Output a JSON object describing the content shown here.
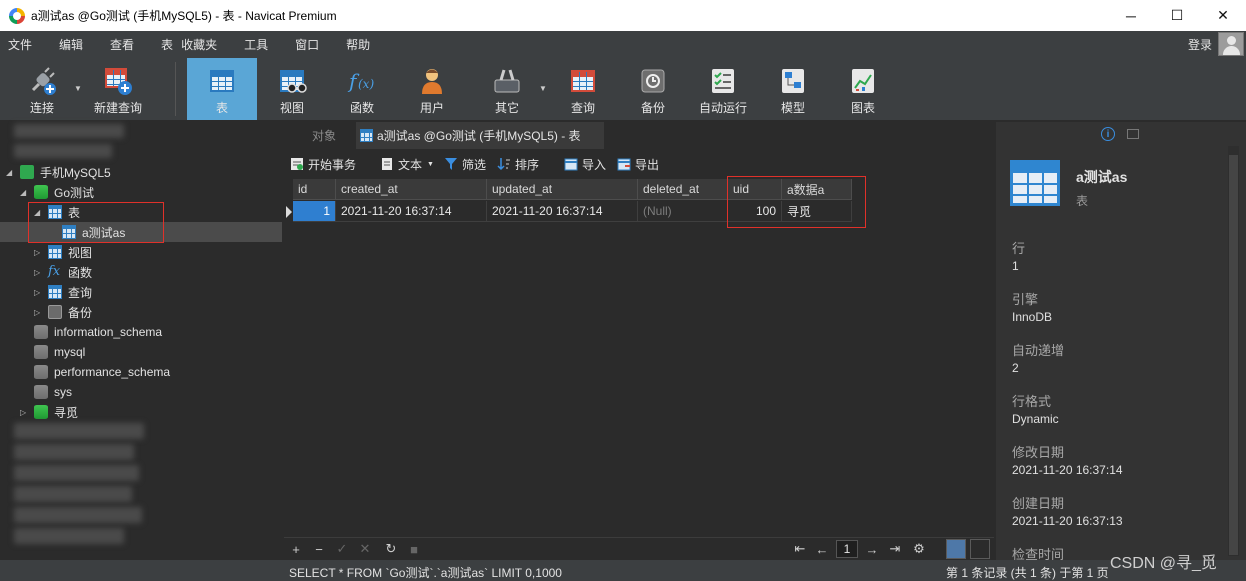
{
  "window": {
    "title": "a测试as @Go测试 (手机MySQL5) - 表 - Navicat Premium",
    "min_glyph": "─",
    "max_glyph": "☐",
    "close_glyph": "✕"
  },
  "menu": [
    "文件",
    "编辑",
    "查看",
    "表",
    "收藏夹",
    "工具",
    "窗口",
    "帮助"
  ],
  "account": {
    "login_label": "登录"
  },
  "toolbar": {
    "items": [
      {
        "label": "连接",
        "icon": "plug-icon"
      },
      {
        "label": "新建查询",
        "icon": "new-query-icon"
      },
      {
        "label": "表",
        "icon": "table-icon",
        "active": true
      },
      {
        "label": "视图",
        "icon": "view-icon"
      },
      {
        "label": "函数",
        "icon": "function-icon"
      },
      {
        "label": "用户",
        "icon": "user-icon"
      },
      {
        "label": "其它",
        "icon": "tools-icon"
      },
      {
        "label": "查询",
        "icon": "query-icon"
      },
      {
        "label": "备份",
        "icon": "backup-icon"
      },
      {
        "label": "自动运行",
        "icon": "automation-icon"
      },
      {
        "label": "模型",
        "icon": "model-icon"
      },
      {
        "label": "图表",
        "icon": "chart-icon"
      }
    ]
  },
  "nav": {
    "connection": "手机MySQL5",
    "database": "Go测试",
    "tables_node": "表",
    "table": "a测试as",
    "views": "视图",
    "functions": "函数",
    "queries": "查询",
    "backups": "备份",
    "other_dbs": [
      "information_schema",
      "mysql",
      "performance_schema",
      "sys"
    ],
    "db2": "寻觅",
    "fx_glyph": "fx"
  },
  "tabs": {
    "objects": "对象",
    "current": "a测试as @Go测试 (手机MySQL5) - 表"
  },
  "actions": {
    "begin_transaction": "开始事务",
    "text": "文本",
    "filter": "筛选",
    "sort": "排序",
    "import": "导入",
    "export": "导出"
  },
  "grid": {
    "columns": [
      "id",
      "created_at",
      "updated_at",
      "deleted_at",
      "uid",
      "a数据a"
    ],
    "rows": [
      [
        "1",
        "2021-11-20 16:37:14",
        "2021-11-20 16:37:14",
        "(Null)",
        "100",
        "寻觅"
      ]
    ]
  },
  "pager": {
    "page": "1"
  },
  "status": {
    "sql": "SELECT * FROM `Go测试`.`a测试as` LIMIT 0,1000",
    "record": "第 1 条记录 (共 1 条) 于第 1 页"
  },
  "details": {
    "title": "a测试as",
    "subtitle": "表",
    "fields": [
      {
        "label": "行",
        "value": "1"
      },
      {
        "label": "引擎",
        "value": "InnoDB"
      },
      {
        "label": "自动递增",
        "value": "2"
      },
      {
        "label": "行格式",
        "value": "Dynamic"
      },
      {
        "label": "修改日期",
        "value": "2021-11-20 16:37:14"
      },
      {
        "label": "创建日期",
        "value": "2021-11-20 16:37:13"
      },
      {
        "label": "检查时间",
        "value": ""
      }
    ]
  },
  "watermark": "CSDN @寻_觅",
  "colors": {
    "accent": "#5aa6d6",
    "selection": "#2f7fd0",
    "highlight_box": "#e0312a"
  }
}
